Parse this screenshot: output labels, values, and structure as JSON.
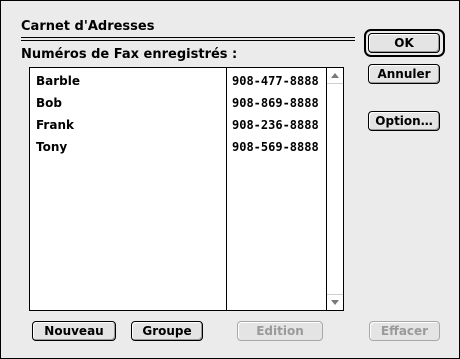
{
  "dialog": {
    "title": "Carnet d'Adresses",
    "subtitle": "Numéros de Fax enregistrés :"
  },
  "contacts": [
    {
      "name": "Barble",
      "number": "908-477-8888"
    },
    {
      "name": "Bob",
      "number": "908-869-8888"
    },
    {
      "name": "Frank",
      "number": "908-236-8888"
    },
    {
      "name": "Tony",
      "number": "908-569-8888"
    }
  ],
  "buttons": {
    "ok": "OK",
    "cancel": "Annuler",
    "option": "Option…",
    "new": "Nouveau",
    "group": "Groupe",
    "edit": "Edition",
    "delete": "Effacer"
  },
  "icons": {
    "scroll_up": "scroll-up-arrow-icon",
    "scroll_down": "scroll-down-arrow-icon"
  }
}
